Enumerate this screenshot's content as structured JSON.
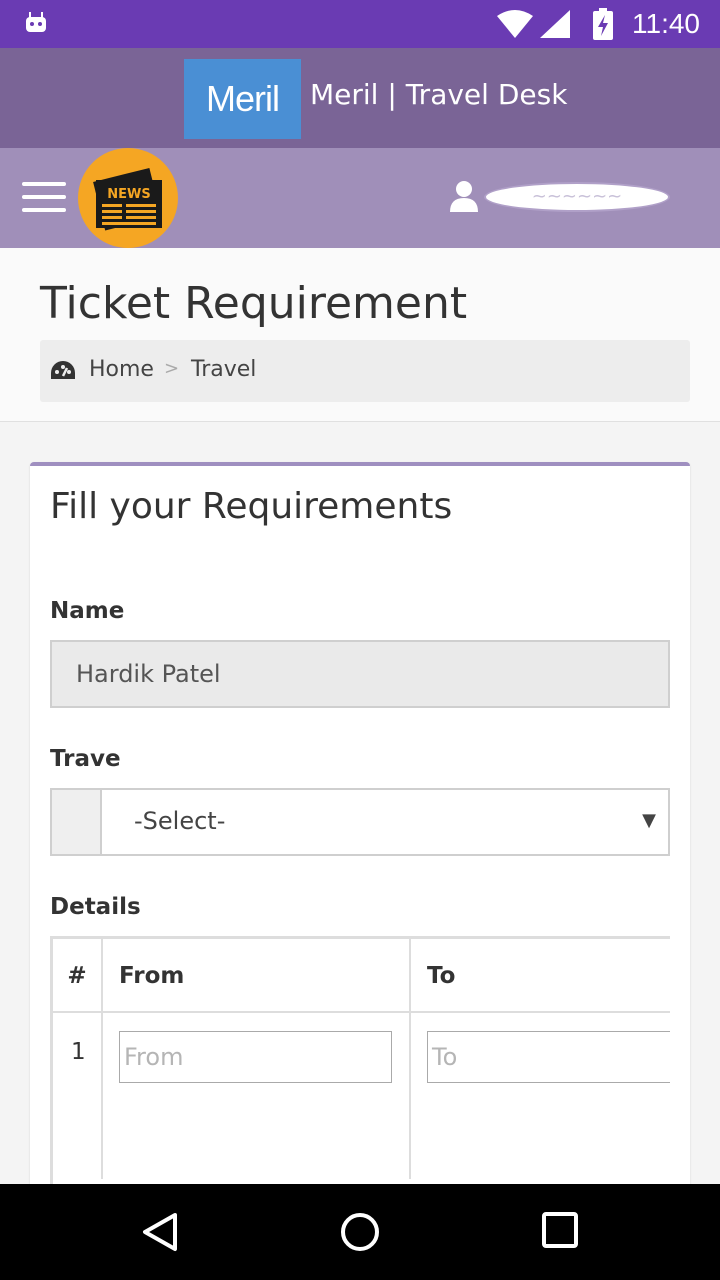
{
  "status_bar": {
    "time": "11:40"
  },
  "header": {
    "logo_text": "Meril",
    "title": "Meril | Travel Desk"
  },
  "navbar": {
    "news_label": "NEWS",
    "user_name": "~~~~~~"
  },
  "page": {
    "title": "Ticket Requirement",
    "breadcrumb": {
      "home": "Home",
      "separator": ">",
      "current": "Travel"
    }
  },
  "form": {
    "title": "Fill your Requirements",
    "name_label": "Name",
    "name_value": "Hardik Patel",
    "travel_label": "Trave",
    "travel_selected": "-Select-",
    "details_label": "Details",
    "table": {
      "headers": [
        "#",
        "From",
        "To"
      ],
      "rows": [
        {
          "num": "1",
          "from_placeholder": "From",
          "to_placeholder": "To"
        }
      ]
    }
  },
  "colors": {
    "status_bar": "#6a3bb3",
    "brand_bar": "#7a6496",
    "nav_bar": "#a08fb9",
    "logo_bg": "#4a8fd4",
    "news_badge": "#f5a623"
  }
}
